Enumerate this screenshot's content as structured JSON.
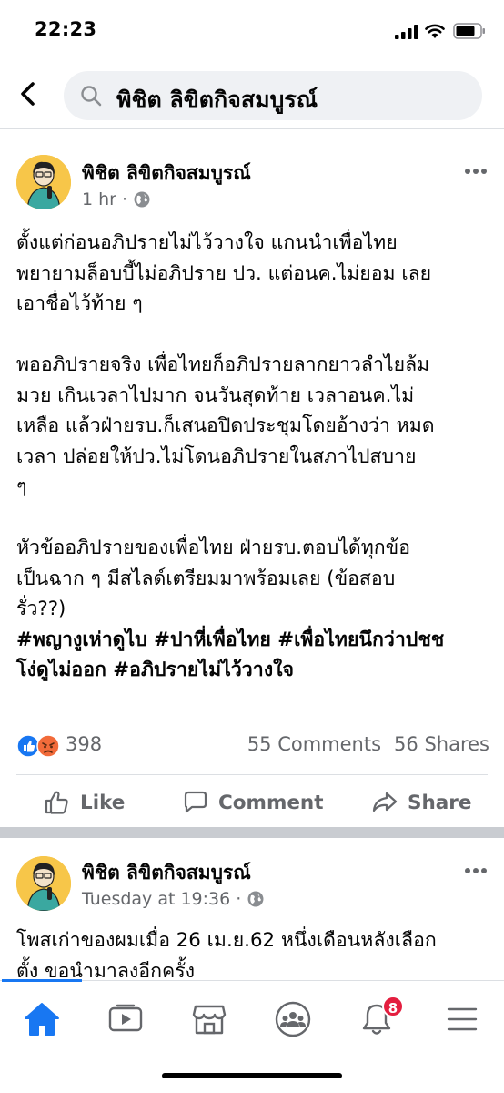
{
  "status_bar": {
    "time": "22:23"
  },
  "search": {
    "query": "พิชิต ลิขิตกิจสมบูรณ์"
  },
  "post1": {
    "author": "พิชิต ลิขิตกิจสมบูรณ์",
    "time": "1 hr",
    "text": "ตั้งแต่ก่อนอภิปรายไม่ไว้วางใจ แกนนำเพื่อไทย\nพยายามล็อบบี้ไม่อภิปราย ปว. แต่อนค.ไม่ยอม เลย\nเอาชื่อไว้ท้าย ๆ\n\nพออภิปรายจริง เพื่อไทยก็อภิปรายลากยาวลำไยล้ม\nมวย เกินเวลาไปมาก จนวันสุดท้าย เวลาอนค.ไม่\nเหลือ แล้วฝ่ายรบ.ก็เสนอปิดประชุมโดยอ้างว่า หมด\nเวลา ปล่อยให้ปว.ไม่โดนอภิปรายในสภาไปสบาย\nๆ\n\nหัวข้ออภิปรายของเพื่อไทย ฝ่ายรบ.ตอบได้ทุกข้อ\nเป็นฉาก ๆ มีสไลด์เตรียมมาพร้อมเลย (ข้อสอบ\nรั่ว??)\n",
    "hashtags": "#พญางูเห่าดูไบ #ปาหี่เพื่อไทย #เพื่อไทยนึกว่าปชช\nโง่ดูไม่ออก #อภิปรายไม่ไว้วางใจ",
    "reaction_count": "398",
    "comments": "55 Comments",
    "shares": "56 Shares"
  },
  "actions": {
    "like": "Like",
    "comment": "Comment",
    "share": "Share"
  },
  "post2": {
    "author": "พิชิต ลิขิตกิจสมบูรณ์",
    "time": "Tuesday at 19:36",
    "text": "โพสเก่าของผมเมื่อ 26 เม.ย.62 หนึ่งเดือนหลังเลือก\nตั้ง ขอนำมาลงอีกครั้ง"
  },
  "bottom_nav": {
    "items": [
      "home-icon",
      "watch-icon",
      "marketplace-icon",
      "groups-icon",
      "notifications-icon",
      "menu-icon"
    ],
    "notifications_badge": "8"
  },
  "colors": {
    "accent": "#1877f2",
    "text_secondary": "#65676b",
    "separator": "#c9ccd1",
    "badge": "#e41e3f",
    "avatar_bg": "#f7c649"
  }
}
